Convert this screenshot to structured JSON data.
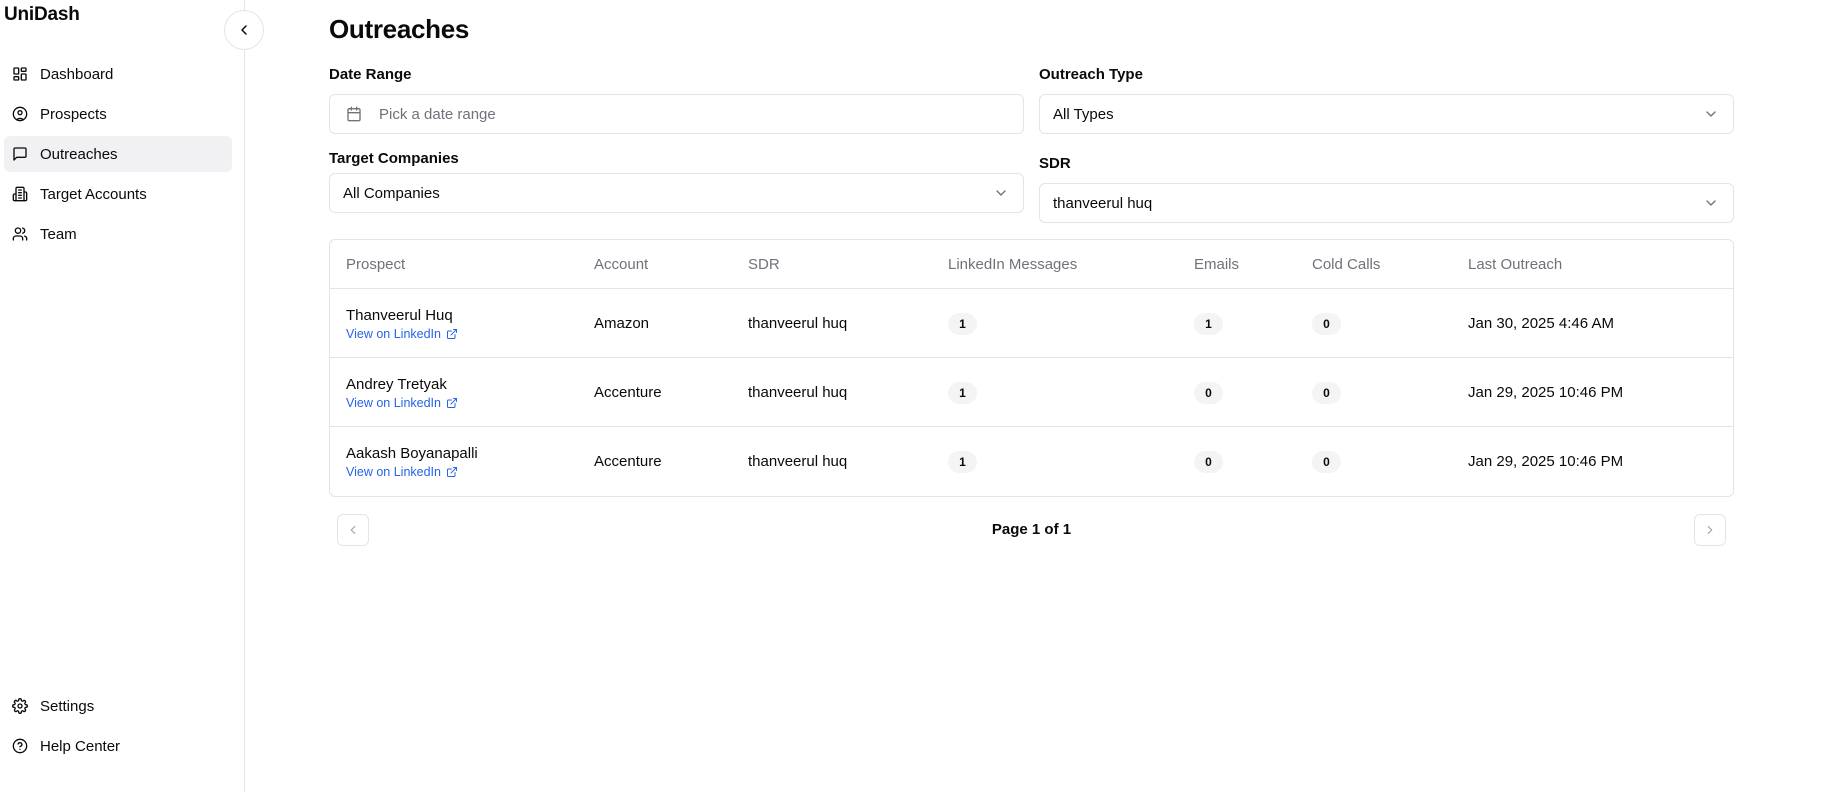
{
  "app": {
    "name": "UniDash"
  },
  "sidebar": {
    "items": [
      {
        "label": "Dashboard",
        "icon": "dashboard-icon",
        "active": false
      },
      {
        "label": "Prospects",
        "icon": "user-circle-icon",
        "active": false
      },
      {
        "label": "Outreaches",
        "icon": "message-square-icon",
        "active": true
      },
      {
        "label": "Target Accounts",
        "icon": "building-icon",
        "active": false
      },
      {
        "label": "Team",
        "icon": "users-icon",
        "active": false
      }
    ],
    "bottom": [
      {
        "label": "Settings",
        "icon": "gear-icon"
      },
      {
        "label": "Help Center",
        "icon": "help-circle-icon"
      }
    ]
  },
  "page": {
    "title": "Outreaches"
  },
  "filters": {
    "date_range": {
      "label": "Date Range",
      "placeholder": "Pick a date range"
    },
    "outreach_type": {
      "label": "Outreach Type",
      "value": "All Types"
    },
    "target_companies": {
      "label": "Target Companies",
      "value": "All Companies"
    },
    "sdr": {
      "label": "SDR",
      "value": "thanveerul huq"
    }
  },
  "table": {
    "headers": [
      "Prospect",
      "Account",
      "SDR",
      "LinkedIn Messages",
      "Emails",
      "Cold Calls",
      "Last Outreach"
    ],
    "link_text": "View on LinkedIn",
    "rows": [
      {
        "prospect": "Thanveerul Huq",
        "account": "Amazon",
        "sdr": "thanveerul huq",
        "linkedin": "1",
        "emails": "1",
        "calls": "0",
        "last": "Jan 30, 2025 4:46 AM"
      },
      {
        "prospect": "Andrey Tretyak",
        "account": "Accenture",
        "sdr": "thanveerul huq",
        "linkedin": "1",
        "emails": "0",
        "calls": "0",
        "last": "Jan 29, 2025 10:46 PM"
      },
      {
        "prospect": "Aakash Boyanapalli",
        "account": "Accenture",
        "sdr": "thanveerul huq",
        "linkedin": "1",
        "emails": "0",
        "calls": "0",
        "last": "Jan 29, 2025 10:46 PM"
      }
    ]
  },
  "pagination": {
    "text": "Page 1 of 1"
  },
  "colors": {
    "link": "#2563eb",
    "muted": "#71717a",
    "border": "#e4e4e7",
    "active_bg": "#f1f1f3"
  }
}
